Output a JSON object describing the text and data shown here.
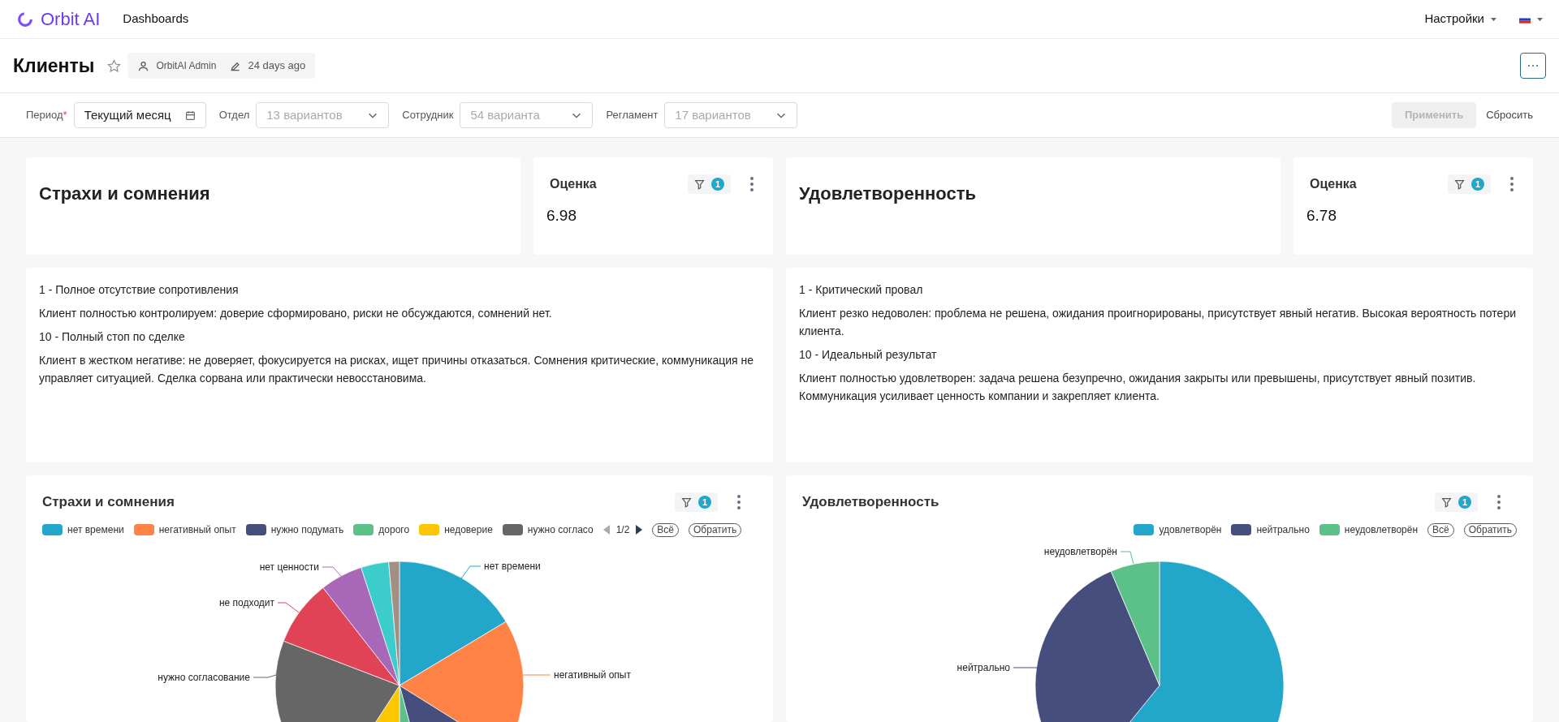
{
  "nav": {
    "logo": "Orbit AI",
    "links": [
      {
        "label": "Dashboards"
      }
    ],
    "settings": "Настройки"
  },
  "header": {
    "title": "Клиенты",
    "starred": false,
    "owner": "OrbitAI Admin",
    "modified": "24 days ago"
  },
  "filters": [
    {
      "kind": "date",
      "label": "Период",
      "required_mark": "*",
      "value": "Текущий месяц"
    },
    {
      "kind": "select",
      "label": "Отдел",
      "placeholder": "13 вариантов"
    },
    {
      "kind": "select",
      "label": "Сотрудник",
      "placeholder": "54 варианта"
    },
    {
      "kind": "select",
      "label": "Регламент",
      "placeholder": "17 вариантов"
    }
  ],
  "actions": {
    "apply": {
      "label": "Применить",
      "disabled": true
    },
    "reset": "Сбросить"
  },
  "columns": [
    {
      "title_card": "Страхи и сомнения",
      "metric": {
        "title": "Оценка",
        "filter_count": "1",
        "value": "6.98"
      },
      "description": [
        "1 - Полное отсутствие сопротивления",
        "Клиент полностью контролируем: доверие сформировано, риски не обсуждаются, сомнений нет.",
        "10 - Полный стоп по сделке",
        "Клиент в жестком негативе: не доверяет, фокусируется на рисках, ищет причины отказаться. Сомнения критические, коммуникация не управляет ситуацией. Сделка сорвана или практически невосстановима."
      ],
      "chart": {
        "title": "Страхи и сомнения",
        "filter_count": "1",
        "legend": [
          {
            "label": "нет времени",
            "color": "#22a7cb"
          },
          {
            "label": "негативный опыт",
            "color": "#ff8347"
          },
          {
            "label": "нужно подумать",
            "color": "#454e7c"
          },
          {
            "label": "дорого",
            "color": "#5bc189"
          },
          {
            "label": "недоверие",
            "color": "#fcc700"
          },
          {
            "label": "нужно согласо",
            "color": "#666666"
          }
        ],
        "pager": "1/2",
        "select_all": "Всё",
        "invert": "Обратить",
        "slice_labels": [
          "нет времени",
          "негативный опыт",
          "нужно согласование",
          "не подходит",
          "нет ценности"
        ]
      }
    },
    {
      "title_card": "Удовлетворенность",
      "metric": {
        "title": "Оценка",
        "filter_count": "1",
        "value": "6.78"
      },
      "description": [
        "1 - Критический провал",
        "Клиент резко недоволен: проблема не решена, ожидания проигнорированы, присутствует явный негатив. Высокая вероятность потери клиента.",
        "10 - Идеальный результат",
        "Клиент полностью удовлетворен: задача решена безупречно, ожидания закрыты или превышены, присутствует явный позитив. Коммуникация усиливает ценность компании и закрепляет клиента."
      ],
      "chart": {
        "title": "Удовлетворенность",
        "filter_count": "1",
        "legend": [
          {
            "label": "удовлетворён",
            "color": "#22a7cb"
          },
          {
            "label": "нейтрально",
            "color": "#454e7c"
          },
          {
            "label": "неудовлетворён",
            "color": "#5bc189"
          }
        ],
        "select_all": "Всё",
        "invert": "Обратить",
        "slice_labels": [
          "неудовлетворён",
          "нейтрально"
        ]
      }
    }
  ]
}
